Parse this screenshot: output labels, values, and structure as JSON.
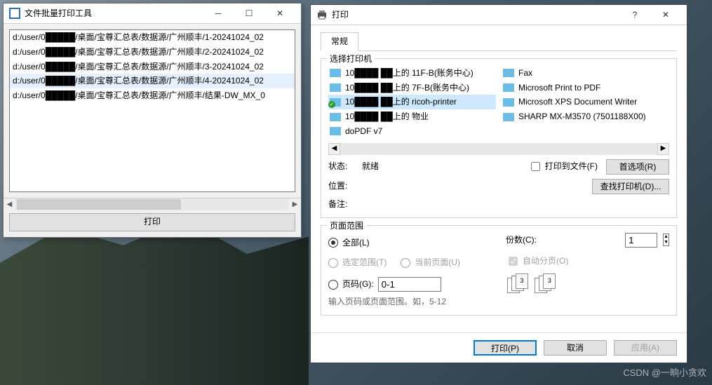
{
  "fileWin": {
    "title": "文件批量打印工具",
    "files": [
      "d:/user/0█████/桌面/宝尊汇总表/数据源/广州顺丰/1-20241024_02",
      "d:/user/0█████/桌面/宝尊汇总表/数据源/广州顺丰/2-20241024_02",
      "d:/user/0█████/桌面/宝尊汇总表/数据源/广州顺丰/3-20241024_02",
      "d:/user/0█████/桌面/宝尊汇总表/数据源/广州顺丰/4-20241024_02",
      "d:/user/0█████/桌面/宝尊汇总表/数据源/广州顺丰/结果-DW_MX_0"
    ],
    "printBtn": "打印"
  },
  "printDlg": {
    "title": "打印",
    "tab": "常规",
    "selectPrinterLabel": "选择打印机",
    "printersLeft": [
      {
        "name": "10████ ██上的 11F-B(账务中心)",
        "default": false
      },
      {
        "name": "10████ ██上的 7F-B(账务中心)",
        "default": false
      },
      {
        "name": "10████ ██上的 ricoh-printer",
        "default": true,
        "selected": true
      },
      {
        "name": "10████ ██上的 物业",
        "default": false
      },
      {
        "name": "doPDF v7",
        "default": false
      }
    ],
    "printersRight": [
      {
        "name": "Fax"
      },
      {
        "name": "Microsoft Print to PDF"
      },
      {
        "name": "Microsoft XPS Document Writer"
      },
      {
        "name": "SHARP MX-M3570 (7501188X00)"
      }
    ],
    "statusLabel": "状态:",
    "statusVal": "就绪",
    "locationLabel": "位置:",
    "commentLabel": "备注:",
    "printToFile": "打印到文件(F)",
    "prefsBtn": "首选项(R)",
    "findPrinterBtn": "查找打印机(D)...",
    "rangeLabel": "页面范围",
    "rAll": "全部(L)",
    "rSel": "选定范围(T)",
    "rCur": "当前页面(U)",
    "rPages": "页码(G):",
    "rPagesVal": "0-1",
    "rHint": "输入页码或页面范围。如，5-12",
    "copiesLabel": "份数(C):",
    "copiesVal": "1",
    "collate": "自动分页(O)",
    "okBtn": "打印(P)",
    "cancelBtn": "取消",
    "applyBtn": "应用(A)"
  },
  "watermark": "CSDN @一晌小贪欢"
}
